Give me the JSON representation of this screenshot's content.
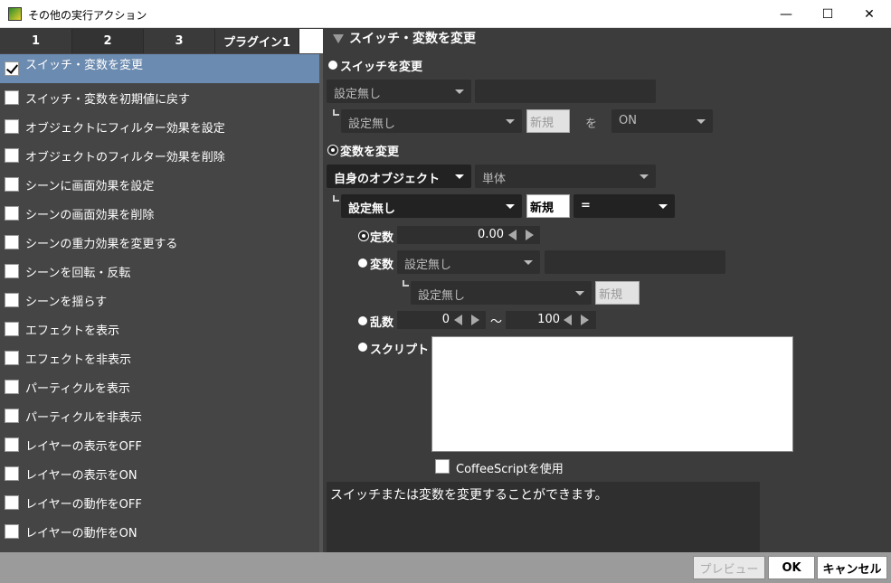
{
  "window": {
    "title": "その他の実行アクション",
    "minimize": "—",
    "maximize": "☐",
    "close": "✕"
  },
  "tabs": [
    {
      "label": "1"
    },
    {
      "label": "2"
    },
    {
      "label": "3"
    },
    {
      "label": "プラグイン1"
    }
  ],
  "actions": [
    {
      "label": "スイッチ・変数を変更",
      "checked": true,
      "selected": true
    },
    {
      "label": "スイッチ・変数を初期値に戻す",
      "checked": false
    },
    {
      "label": "オブジェクトにフィルター効果を設定",
      "checked": false
    },
    {
      "label": "オブジェクトのフィルター効果を削除",
      "checked": false
    },
    {
      "label": "シーンに画面効果を設定",
      "checked": false
    },
    {
      "label": "シーンの画面効果を削除",
      "checked": false
    },
    {
      "label": "シーンの重力効果を変更する",
      "checked": false
    },
    {
      "label": "シーンを回転・反転",
      "checked": false
    },
    {
      "label": "シーンを揺らす",
      "checked": false
    },
    {
      "label": "エフェクトを表示",
      "checked": false
    },
    {
      "label": "エフェクトを非表示",
      "checked": false
    },
    {
      "label": "パーティクルを表示",
      "checked": false
    },
    {
      "label": "パーティクルを非表示",
      "checked": false
    },
    {
      "label": "レイヤーの表示をOFF",
      "checked": false
    },
    {
      "label": "レイヤーの表示をON",
      "checked": false
    },
    {
      "label": "レイヤーの動作をOFF",
      "checked": false
    },
    {
      "label": "レイヤーの動作をON",
      "checked": false
    }
  ],
  "panel": {
    "title": "スイッチ・変数を変更",
    "switch_radio": "スイッチを変更",
    "switch_object": "設定無し",
    "switch_name": "",
    "switch_setting": "設定無し",
    "switch_new": "新規",
    "switch_wo": "を",
    "switch_value": "ON",
    "var_radio": "変数を変更",
    "var_object": "自身のオブジェクト",
    "var_scope": "単体",
    "var_setting": "設定無し",
    "var_new": "新規",
    "var_operator": "=",
    "const_label": "定数",
    "const_value": "0.00",
    "variable_label": "変数",
    "variable_object": "設定無し",
    "variable_setting": "設定無し",
    "variable_new": "新規",
    "random_label": "乱数",
    "random_min": "0",
    "random_tilde": "〜",
    "random_max": "100",
    "script_label": "スクリプト",
    "coffee_label": "CoffeeScriptを使用",
    "description": "スイッチまたは変数を変更することができます。"
  },
  "footer": {
    "preview": "プレビュー",
    "ok": "OK",
    "cancel": "キャンセル"
  }
}
